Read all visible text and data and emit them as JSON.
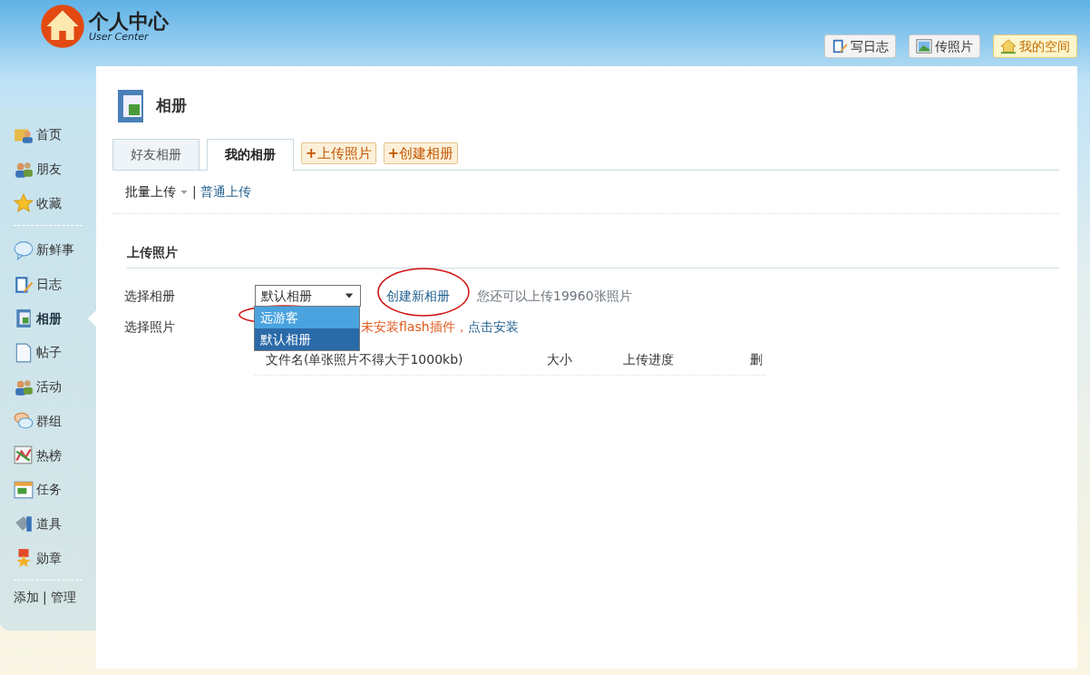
{
  "logo": {
    "title": "个人中心",
    "subtitle": "User Center"
  },
  "header_buttons": [
    {
      "kind": "blog",
      "label": "写日志",
      "highlight": false
    },
    {
      "kind": "photo",
      "label": "传照片",
      "highlight": false
    },
    {
      "kind": "home",
      "label": "我的空间",
      "highlight": true
    }
  ],
  "sidebar": {
    "groups": [
      [
        {
          "label": "首页",
          "selected": false
        },
        {
          "label": "朋友",
          "selected": false
        },
        {
          "label": "收藏",
          "selected": false
        }
      ],
      [
        {
          "label": "新鲜事",
          "selected": false
        },
        {
          "label": "日志",
          "selected": false
        },
        {
          "label": "相册",
          "selected": true
        },
        {
          "label": "帖子",
          "selected": false
        },
        {
          "label": "活动",
          "selected": false
        },
        {
          "label": "群组",
          "selected": false
        },
        {
          "label": "热榜",
          "selected": false
        },
        {
          "label": "任务",
          "selected": false
        },
        {
          "label": "道具",
          "selected": false
        },
        {
          "label": "勋章",
          "selected": false
        }
      ]
    ],
    "footer_links": [
      "添加",
      "管理"
    ],
    "footer_separator": "|"
  },
  "page": {
    "title": "相册",
    "tabs": [
      {
        "label": "好友相册",
        "selected": false
      },
      {
        "label": "我的相册",
        "selected": true
      }
    ],
    "tab_actions": [
      "**+**上传照片",
      "**+**创建相册"
    ],
    "upload_modes": [
      {
        "label": "批量上传",
        "kind": "dropdown"
      },
      {
        "label": "|",
        "kind": "separator"
      },
      {
        "label": "普通上传",
        "kind": "link"
      }
    ],
    "section_title": "上传照片",
    "album_label": "选择相册",
    "album_select": {
      "value": "默认相册",
      "options": [
        {
          "label": "远游客",
          "hovered": true,
          "selected": false
        },
        {
          "label": "默认相册",
          "hovered": false,
          "selected": true
        }
      ]
    },
    "create_album_link": "创建新相册",
    "quota_text": "您还可以上传19960张照片",
    "photo_label": "选择照片",
    "flash_warning": "未安装flash插件，",
    "install_link": "点击安装",
    "table": {
      "columns": [
        "文件名(单张照片不得大于1000kb)",
        "大小",
        "上传进度",
        "删"
      ]
    }
  }
}
